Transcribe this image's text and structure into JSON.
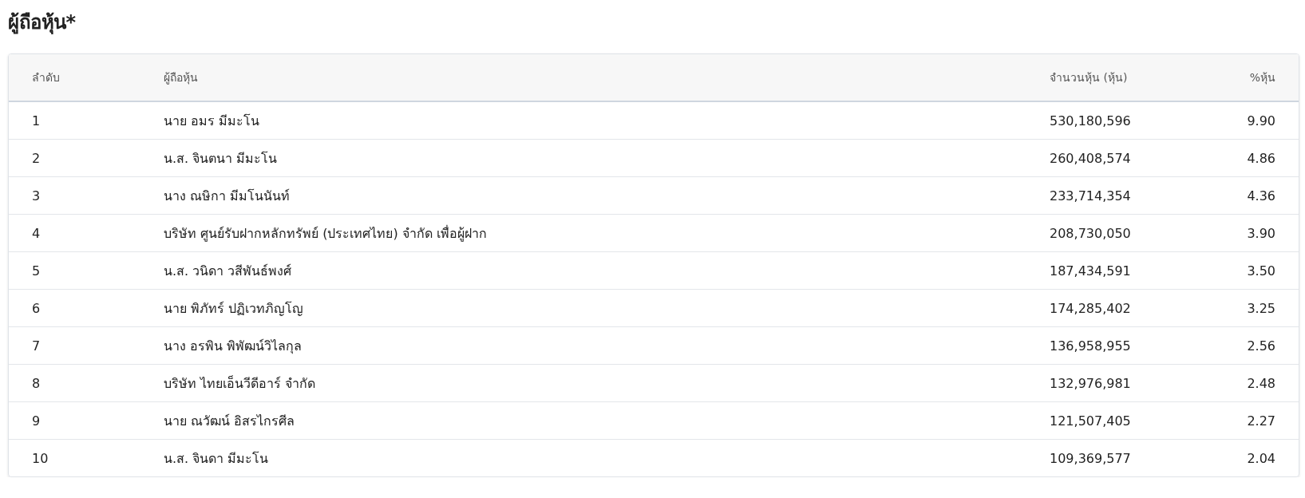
{
  "title": "ผู้ถือหุ้น*",
  "table": {
    "columns": [
      "ลำดับ",
      "ผู้ถือหุ้น",
      "จำนวนหุ้น (หุ้น)",
      "%หุ้น"
    ],
    "rows": [
      [
        "1",
        "นาย อมร มีมะโน",
        "530,180,596",
        "9.90"
      ],
      [
        "2",
        "น.ส. จินตนา มีมะโน",
        "260,408,574",
        "4.86"
      ],
      [
        "3",
        "นาง ณษิกา มีมโนนันท์",
        "233,714,354",
        "4.36"
      ],
      [
        "4",
        "บริษัท ศูนย์รับฝากหลักทรัพย์ (ประเทศไทย) จำกัด เพื่อผู้ฝาก",
        "208,730,050",
        "3.90"
      ],
      [
        "5",
        "น.ส. วนิดา วสีพันธ์พงศ์",
        "187,434,591",
        "3.50"
      ],
      [
        "6",
        "นาย พิภัทร์ ปฏิเวทภิญโญ",
        "174,285,402",
        "3.25"
      ],
      [
        "7",
        "นาง อรพิน พิพัฒน์วิไลกุล",
        "136,958,955",
        "2.56"
      ],
      [
        "8",
        "บริษัท ไทยเอ็นวีดีอาร์ จำกัด",
        "132,976,981",
        "2.48"
      ],
      [
        "9",
        "นาย ณวัฒน์ อิสรไกรศีล",
        "121,507,405",
        "2.27"
      ],
      [
        "10",
        "น.ส. จินดา มีมะโน",
        "109,369,577",
        "2.04"
      ]
    ]
  }
}
